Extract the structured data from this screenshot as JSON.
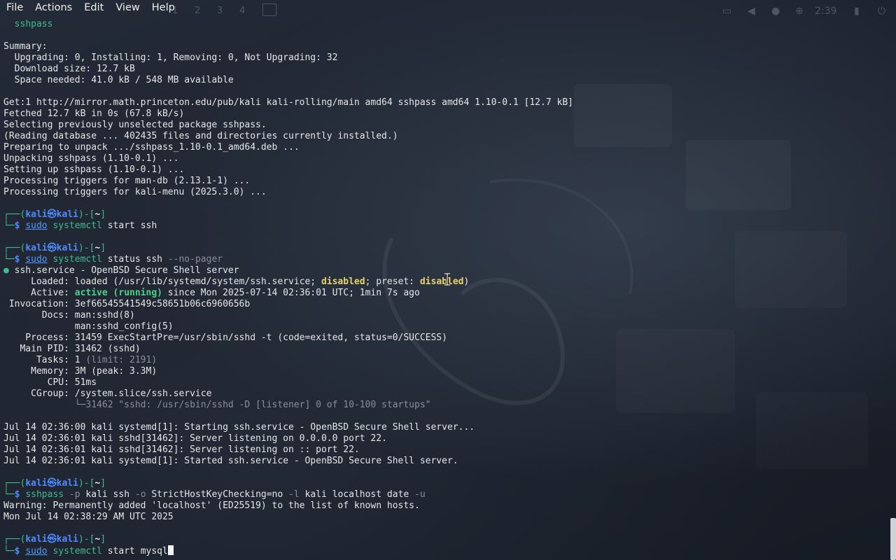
{
  "menubar": {
    "items": [
      "File",
      "Actions",
      "Edit",
      "View",
      "Help"
    ]
  },
  "panel": {
    "workspaces": [
      "1",
      "2",
      "3",
      "4"
    ],
    "clock": "2:39"
  },
  "terminal": {
    "lines": [
      [
        {
          "t": "  sshpass",
          "c": "c-green"
        }
      ],
      [
        {
          "t": ""
        }
      ],
      [
        {
          "t": "Summary:"
        }
      ],
      [
        {
          "t": "  Upgrading: 0, Installing: 1, Removing: 0, Not Upgrading: 32"
        }
      ],
      [
        {
          "t": "  Download size: 12.7 kB"
        }
      ],
      [
        {
          "t": "  Space needed: 41.0 kB / 548 MB available"
        }
      ],
      [
        {
          "t": ""
        }
      ],
      [
        {
          "t": "Get:1 http://mirror.math.princeton.edu/pub/kali kali-rolling/main amd64 sshpass amd64 1.10-0.1 [12.7 kB]"
        }
      ],
      [
        {
          "t": "Fetched 12.7 kB in 0s (67.8 kB/s)"
        }
      ],
      [
        {
          "t": "Selecting previously unselected package sshpass."
        }
      ],
      [
        {
          "t": "(Reading database ... 402435 files and directories currently installed.)"
        }
      ],
      [
        {
          "t": "Preparing to unpack .../sshpass_1.10-0.1_amd64.deb ..."
        }
      ],
      [
        {
          "t": "Unpacking sshpass (1.10-0.1) ..."
        }
      ],
      [
        {
          "t": "Setting up sshpass (1.10-0.1) ..."
        }
      ],
      [
        {
          "t": "Processing triggers for man-db (2.13.1-1) ..."
        }
      ],
      [
        {
          "t": "Processing triggers for kali-menu (2025.3.0) ..."
        }
      ],
      [
        {
          "t": ""
        }
      ],
      [
        {
          "t": "┌──(",
          "c": "c-green"
        },
        {
          "t": "kali㉿kali",
          "c": "c-prompt-kali"
        },
        {
          "t": ")-[",
          "c": "c-green"
        },
        {
          "t": "~",
          "c": "c-bold"
        },
        {
          "t": "]",
          "c": "c-green"
        }
      ],
      [
        {
          "t": "└─",
          "c": "c-green"
        },
        {
          "t": "$ ",
          "c": "c-prompt-kali"
        },
        {
          "t": "sudo",
          "c": "c-link"
        },
        {
          "t": " systemctl",
          "c": "c-green"
        },
        {
          "t": " start ssh"
        }
      ],
      [
        {
          "t": ""
        }
      ],
      [
        {
          "t": "┌──(",
          "c": "c-green"
        },
        {
          "t": "kali㉿kali",
          "c": "c-prompt-kali"
        },
        {
          "t": ")-[",
          "c": "c-green"
        },
        {
          "t": "~",
          "c": "c-bold"
        },
        {
          "t": "]",
          "c": "c-green"
        }
      ],
      [
        {
          "t": "└─",
          "c": "c-green"
        },
        {
          "t": "$ ",
          "c": "c-prompt-kali"
        },
        {
          "t": "sudo",
          "c": "c-link"
        },
        {
          "t": " systemctl",
          "c": "c-green"
        },
        {
          "t": " status ssh "
        },
        {
          "t": "--no-pager",
          "c": "c-dim"
        }
      ],
      [
        {
          "t": "● ",
          "c": "c-dot"
        },
        {
          "t": "ssh.service - OpenBSD Secure Shell server"
        }
      ],
      [
        {
          "t": "     Loaded: loaded (/usr/lib/systemd/system/ssh.service; "
        },
        {
          "t": "disabled",
          "c": "c-yellow"
        },
        {
          "t": "; preset: "
        },
        {
          "t": "disabled",
          "c": "c-yellow"
        },
        {
          "t": ")"
        }
      ],
      [
        {
          "t": "     Active: "
        },
        {
          "t": "active (running)",
          "c": "c-active"
        },
        {
          "t": " since Mon 2025-07-14 02:36:01 UTC; 1min 7s ago"
        }
      ],
      [
        {
          "t": " Invocation: 3ef66545541549c58651b06c6960656b"
        }
      ],
      [
        {
          "t": "       Docs: man:sshd(8)"
        }
      ],
      [
        {
          "t": "             man:sshd_config(5)"
        }
      ],
      [
        {
          "t": "    Process: 31459 ExecStartPre=/usr/sbin/sshd -t (code=exited, status=0/SUCCESS)"
        }
      ],
      [
        {
          "t": "   Main PID: 31462 (sshd)"
        }
      ],
      [
        {
          "t": "      Tasks: 1 "
        },
        {
          "t": "(limit: 2191)",
          "c": "c-dim"
        }
      ],
      [
        {
          "t": "     Memory: 3M (peak: 3.3M)"
        }
      ],
      [
        {
          "t": "        CPU: 51ms"
        }
      ],
      [
        {
          "t": "     CGroup: /system.slice/ssh.service"
        }
      ],
      [
        {
          "t": "             └─31462 \"sshd: /usr/sbin/sshd -D [listener] 0 of 10-100 startups\"",
          "c": "c-dim"
        }
      ],
      [
        {
          "t": ""
        }
      ],
      [
        {
          "t": "Jul 14 02:36:00 kali systemd[1]: Starting ssh.service - OpenBSD Secure Shell server..."
        }
      ],
      [
        {
          "t": "Jul 14 02:36:01 kali sshd[31462]: Server listening on 0.0.0.0 port 22."
        }
      ],
      [
        {
          "t": "Jul 14 02:36:01 kali sshd[31462]: Server listening on :: port 22."
        }
      ],
      [
        {
          "t": "Jul 14 02:36:01 kali systemd[1]: Started ssh.service - OpenBSD Secure Shell server."
        }
      ],
      [
        {
          "t": ""
        }
      ],
      [
        {
          "t": "┌──(",
          "c": "c-green"
        },
        {
          "t": "kali㉿kali",
          "c": "c-prompt-kali"
        },
        {
          "t": ")-[",
          "c": "c-green"
        },
        {
          "t": "~",
          "c": "c-bold"
        },
        {
          "t": "]",
          "c": "c-green"
        }
      ],
      [
        {
          "t": "└─",
          "c": "c-green"
        },
        {
          "t": "$ ",
          "c": "c-prompt-kali"
        },
        {
          "t": "sshpass",
          "c": "c-green"
        },
        {
          "t": " -p",
          "c": "c-dim"
        },
        {
          "t": " kali ssh"
        },
        {
          "t": " -o",
          "c": "c-dim"
        },
        {
          "t": " StrictHostKeyChecking=no"
        },
        {
          "t": " -l",
          "c": "c-dim"
        },
        {
          "t": " kali localhost date"
        },
        {
          "t": " -u",
          "c": "c-dim"
        }
      ],
      [
        {
          "t": "Warning: Permanently added 'localhost' (ED25519) to the list of known hosts."
        }
      ],
      [
        {
          "t": "Mon Jul 14 02:38:29 AM UTC 2025"
        }
      ],
      [
        {
          "t": ""
        }
      ],
      [
        {
          "t": "┌──(",
          "c": "c-green"
        },
        {
          "t": "kali㉿kali",
          "c": "c-prompt-kali"
        },
        {
          "t": ")-[",
          "c": "c-green"
        },
        {
          "t": "~",
          "c": "c-bold"
        },
        {
          "t": "]",
          "c": "c-green"
        }
      ],
      [
        {
          "t": "└─",
          "c": "c-green"
        },
        {
          "t": "$ ",
          "c": "c-prompt-kali"
        },
        {
          "t": "sudo",
          "c": "c-link"
        },
        {
          "t": " systemctl",
          "c": "c-green"
        },
        {
          "t": " start mysql"
        }
      ]
    ],
    "cursor_on_last_line": true
  }
}
